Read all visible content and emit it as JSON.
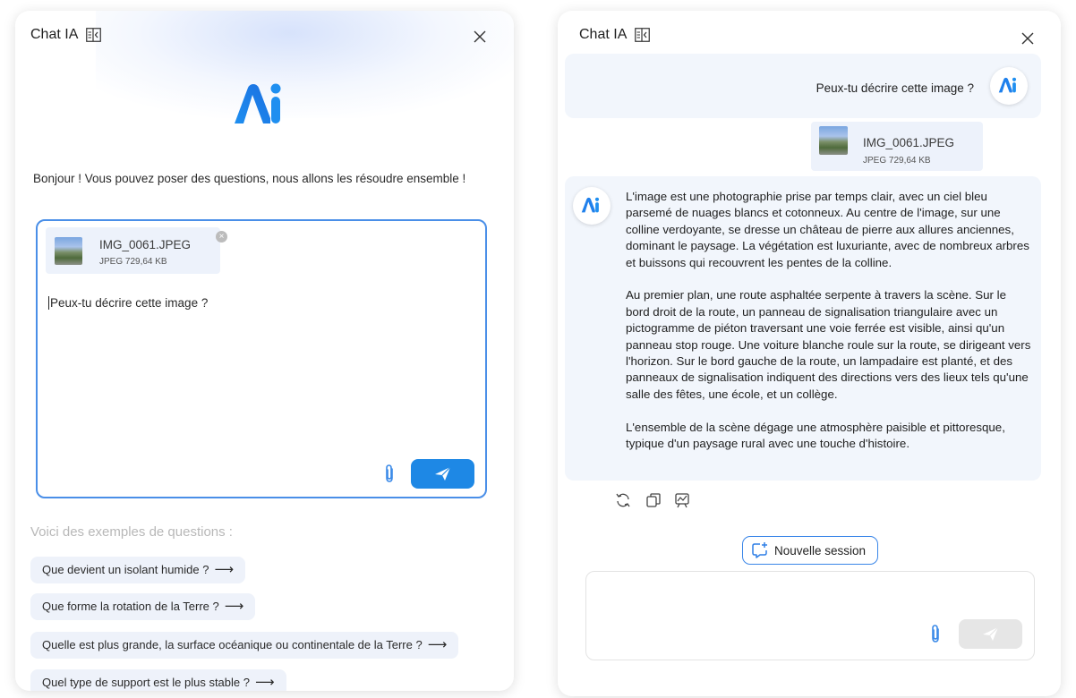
{
  "app": {
    "title": "Chat IA"
  },
  "left_panel": {
    "greeting": "Bonjour ! Vous pouvez poser des questions, nous allons les résoudre ensemble !",
    "attachment": {
      "name": "IMG_0061.JPEG",
      "meta": "JPEG 729,64 KB"
    },
    "prompt_value": "Peux-tu décrire cette image ?",
    "examples_title": "Voici des exemples de questions :",
    "examples": [
      "Que devient un isolant humide ?",
      "Que forme la rotation de la Terre ?",
      "Quelle est plus grande, la surface océanique ou continentale de la Terre ?",
      "Quel type de support est le plus stable ?"
    ]
  },
  "right_panel": {
    "user_message": "Peux-tu décrire cette image ?",
    "attachment": {
      "name": "IMG_0061.JPEG",
      "meta": "JPEG 729,64 KB"
    },
    "ai_paragraphs": [
      "L'image est une photographie prise par temps clair, avec un ciel bleu parsemé de nuages blancs et cotonneux. Au centre de l'image, sur une colline verdoyante, se dresse un château de pierre aux allures anciennes, dominant le paysage. La végétation est luxuriante, avec de nombreux arbres et buissons qui recouvrent les pentes de la colline.",
      "Au premier plan, une route asphaltée serpente à travers la scène. Sur le bord droit de la route, un panneau de signalisation triangulaire avec un pictogramme de piéton traversant une voie ferrée est visible, ainsi qu'un panneau stop rouge. Une voiture blanche roule sur la route, se dirigeant vers l'horizon. Sur le bord gauche de la route, un lampadaire est planté, et des panneaux de signalisation indiquent des directions vers des lieux tels qu'une salle des fêtes, une école, et un collège.",
      "L'ensemble de la scène dégage une atmosphère paisible et pittoresque, typique d'un paysage rural avec une touche d'histoire."
    ],
    "new_session_label": "Nouvelle session",
    "input_value": ""
  },
  "icons": {
    "collapse": "sidebar-collapse-icon",
    "close": "close-icon",
    "attach": "paperclip-icon",
    "send": "send-icon",
    "regenerate": "refresh-icon",
    "copy": "copy-icon",
    "summary": "chart-icon",
    "new_session": "new-chat-icon"
  },
  "colors": {
    "accent": "#2f8cf0",
    "send_active": "#1e88e5",
    "send_disabled": "#e6e6e6",
    "bubble_bg": "#f2f6fc",
    "chip_bg": "#eef2fa"
  }
}
